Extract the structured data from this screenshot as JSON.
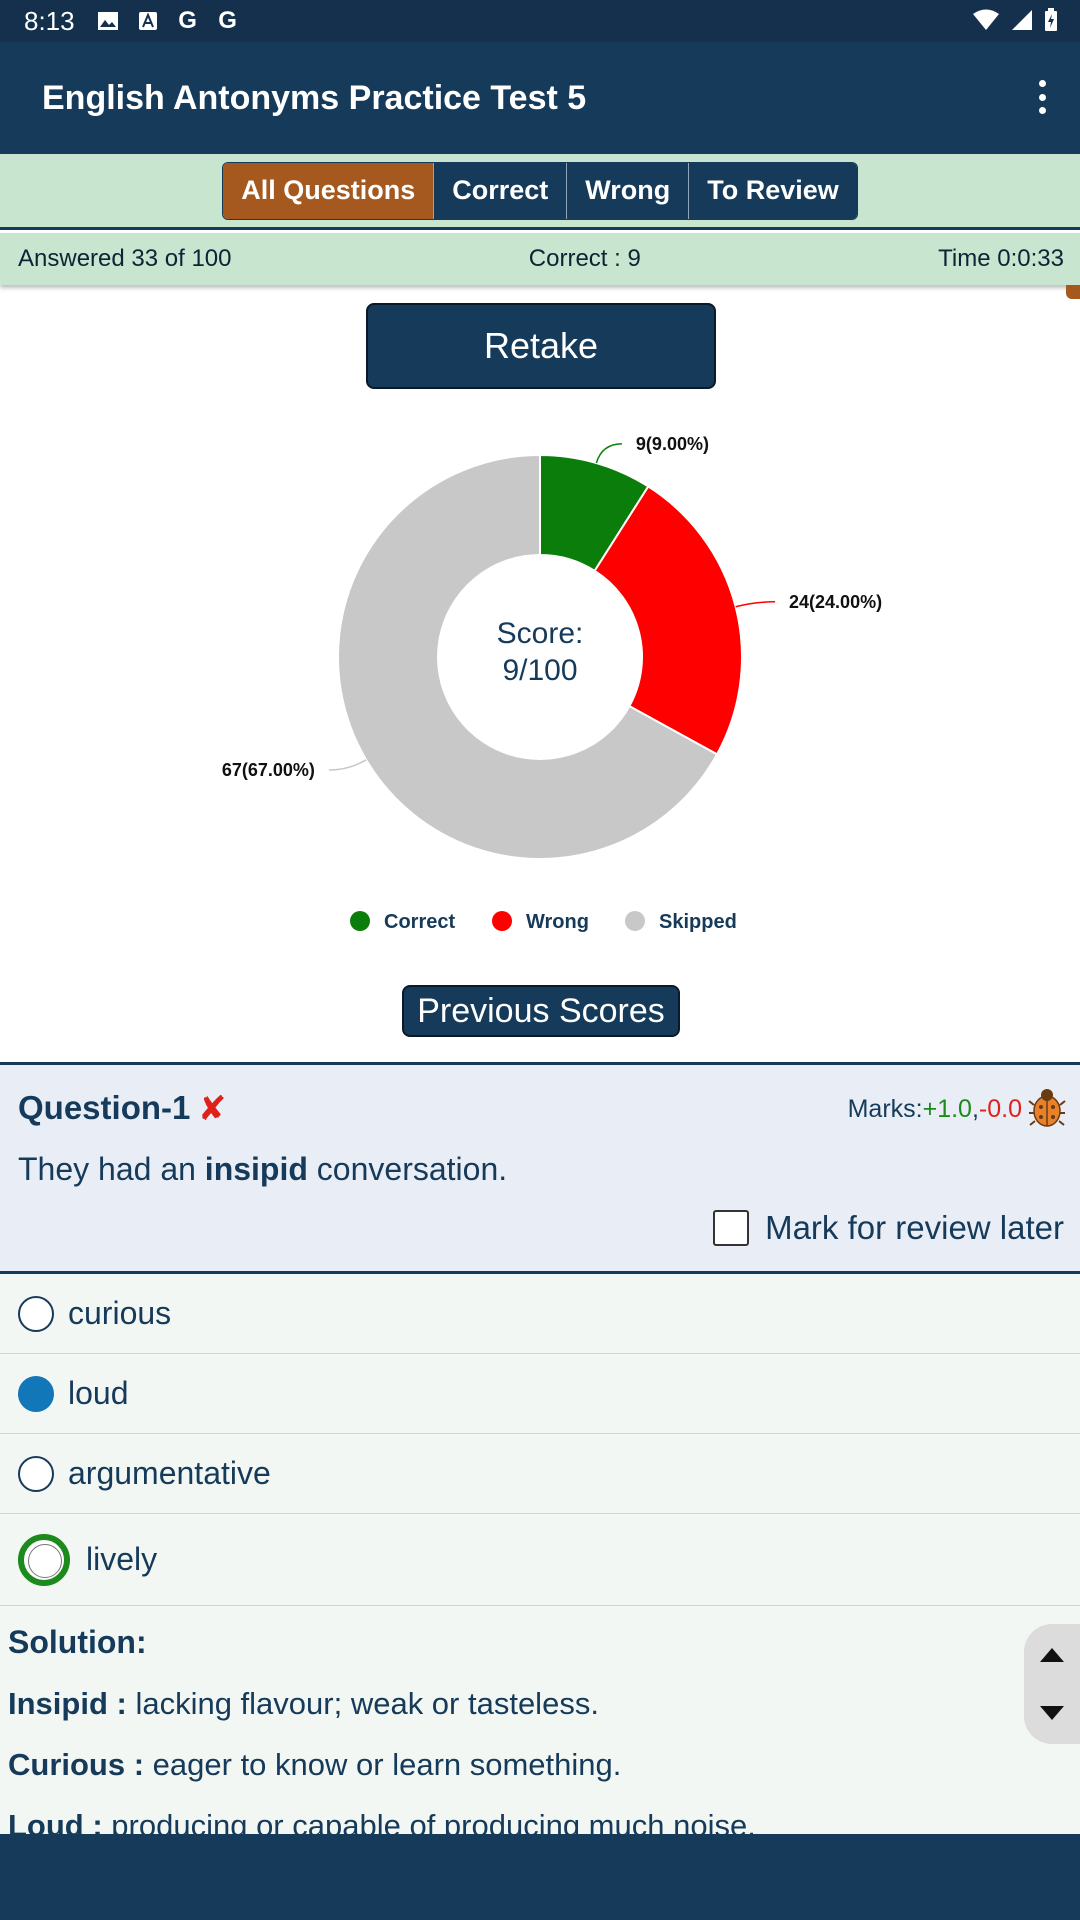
{
  "status_bar": {
    "time": "8:13"
  },
  "app_bar": {
    "title": "English Antonyms Practice Test 5",
    "menu_icon": "more-vert-icon"
  },
  "tabs": [
    {
      "label": "All Questions",
      "active": true
    },
    {
      "label": "Correct",
      "active": false
    },
    {
      "label": "Wrong",
      "active": false
    },
    {
      "label": "To Review",
      "active": false
    }
  ],
  "stats": {
    "answered": "Answered 33 of 100",
    "correct": "Correct : 9",
    "time": "Time 0:0:33"
  },
  "retake_label": "Retake",
  "chart_data": {
    "type": "pie",
    "categories": [
      "Correct",
      "Wrong",
      "Skipped"
    ],
    "values": [
      9,
      24,
      67
    ],
    "data_labels": [
      "9(9.00%)",
      "24(24.00%)",
      "67(67.00%)"
    ],
    "colors": [
      "#0a7d0a",
      "#ff0000",
      "#c8c8c8"
    ],
    "center_text": [
      "Score:",
      "9/100"
    ],
    "legend": "bottom"
  },
  "previous_scores_label": "Previous Scores",
  "question": {
    "title": "Question-1",
    "wrong_mark": "✘",
    "marks_prefix": "Marks:",
    "marks_pos": "+1.0",
    "marks_sep": ",",
    "marks_neg": "-0.0",
    "text_before": "They had an ",
    "text_bold": "insipid",
    "text_after": " conversation.",
    "review_label": "Mark for review later"
  },
  "options": [
    {
      "label": "curious",
      "state": "none"
    },
    {
      "label": "loud",
      "state": "selected"
    },
    {
      "label": "argumentative",
      "state": "none"
    },
    {
      "label": "lively",
      "state": "correct"
    }
  ],
  "solution": {
    "title": "Solution:",
    "lines": [
      {
        "term": "Insipid :",
        "def": " lacking flavour; weak or tasteless."
      },
      {
        "term": "Curious :",
        "def": " eager to know or learn something."
      },
      {
        "term": "Loud :",
        "def": " producing or capable of producing much noise."
      }
    ]
  }
}
